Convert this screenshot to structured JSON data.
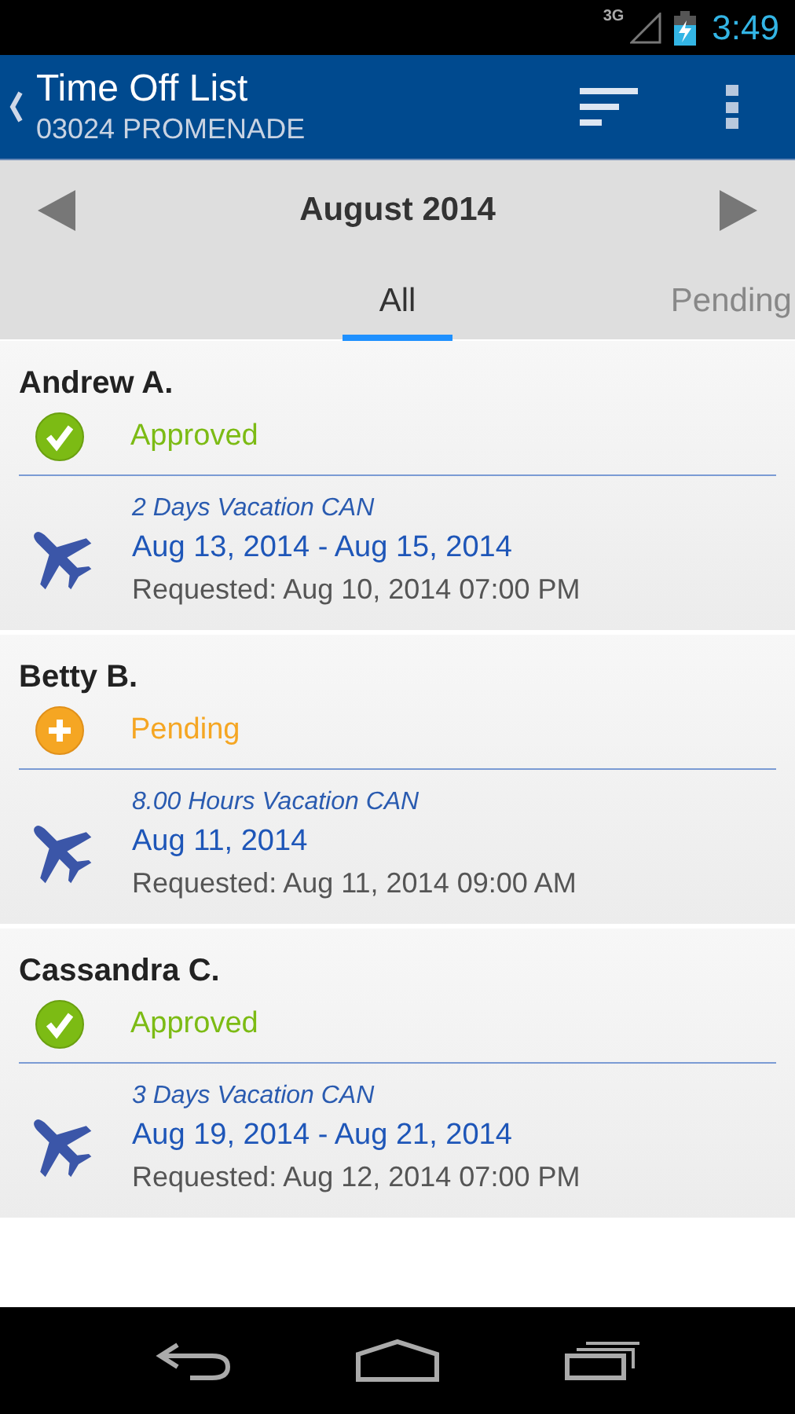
{
  "status_bar": {
    "network": "3G",
    "time": "3:49"
  },
  "header": {
    "title": "Time Off List",
    "subtitle": "03024 PROMENADE"
  },
  "month": "August 2014",
  "tabs": [
    {
      "label": "All",
      "selected": true
    },
    {
      "label": "Pending",
      "selected": false
    }
  ],
  "entries": [
    {
      "name": "Andrew A.",
      "status": {
        "kind": "approved",
        "label": "Approved"
      },
      "type": "2 Days Vacation CAN",
      "dates": "Aug 13, 2014 - Aug 15, 2014",
      "requested": "Requested: Aug 10, 2014 07:00 PM"
    },
    {
      "name": "Betty B.",
      "status": {
        "kind": "pending",
        "label": "Pending"
      },
      "type": "8.00 Hours Vacation CAN",
      "dates": "Aug 11, 2014",
      "requested": "Requested: Aug 11, 2014 09:00 AM"
    },
    {
      "name": "Cassandra C.",
      "status": {
        "kind": "approved",
        "label": "Approved"
      },
      "type": "3 Days Vacation CAN",
      "dates": "Aug 19, 2014 - Aug 21, 2014",
      "requested": "Requested: Aug 12, 2014 07:00 PM"
    }
  ]
}
